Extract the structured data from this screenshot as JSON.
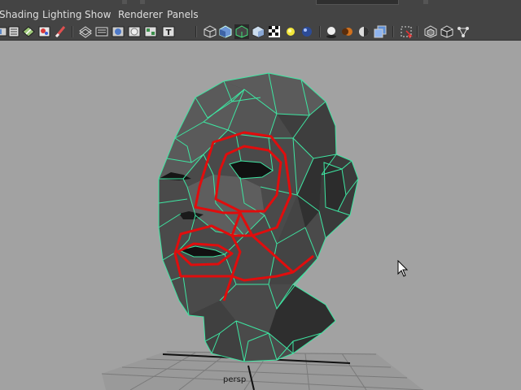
{
  "menubar": {
    "items": [
      {
        "label": "Shading"
      },
      {
        "label": "Lighting"
      },
      {
        "label": "Show"
      },
      {
        "label": "Renderer"
      },
      {
        "label": "Panels"
      }
    ]
  },
  "toolbar": {
    "icons": [
      "camera-select-icon",
      "camera-attributes-icon",
      "bookmarks-icon",
      "image-plane-icon",
      "grid-toggle-icon",
      "film-gate-icon",
      "resolution-gate-icon",
      "gate-mask-icon",
      "field-chart-icon",
      "safe-title-icon",
      "wireframe-icon",
      "smooth-shade-icon",
      "wireframe-on-shaded-icon",
      "flat-shade-icon",
      "default-material-icon",
      "textured-icon",
      "use-lights-icon",
      "shadows-icon",
      "ambient-occlusion-icon",
      "motion-blur-icon",
      "depth-of-field-icon",
      "isolate-select-icon",
      "xray-icon",
      "xray-joints-icon",
      "xray-components-icon"
    ]
  },
  "viewport": {
    "camera_label": "persp",
    "wire_color": "#3ee6a2",
    "selection_color": "#e00d0d",
    "background": "#a2a2a2"
  }
}
